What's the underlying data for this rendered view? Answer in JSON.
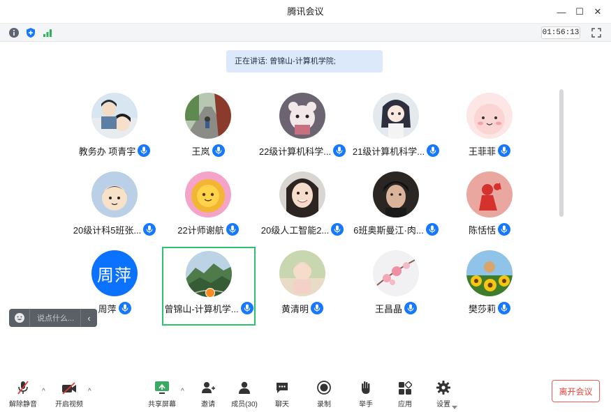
{
  "window": {
    "title": "腾讯会议",
    "minimize_label": "—",
    "maximize_label": "☐",
    "close_label": "✕"
  },
  "toolbar": {
    "timer": "01:56:13"
  },
  "speaking": {
    "text": "正在讲话: 曾锦山-计算机学院;"
  },
  "participants": [
    {
      "name": "教务办 项青宇",
      "avatar": "comic"
    },
    {
      "name": "王岚",
      "avatar": "road"
    },
    {
      "name": "22级计算机科学...",
      "avatar": "plush"
    },
    {
      "name": "21级计算机科学...",
      "avatar": "anime"
    },
    {
      "name": "王菲菲",
      "avatar": "pink-face"
    },
    {
      "name": "20级计科5班张...",
      "avatar": "cartoon-kid"
    },
    {
      "name": "22计师谢航",
      "avatar": "sun"
    },
    {
      "name": "20级人工智能2...",
      "avatar": "girl"
    },
    {
      "name": "6班奥斯曼江·肉...",
      "avatar": "boy"
    },
    {
      "name": "陈恬恬",
      "avatar": "red-figure"
    },
    {
      "name": "周萍",
      "avatar_text": "周萍"
    },
    {
      "name": "曾锦山-计算机学...",
      "avatar": "mountain",
      "active": true
    },
    {
      "name": "黄清明",
      "avatar": "baby"
    },
    {
      "name": "王昌晶",
      "avatar": "blossom"
    },
    {
      "name": "樊莎莉",
      "avatar": "sunflower"
    }
  ],
  "chat": {
    "placeholder": "说点什么..."
  },
  "controls": {
    "unmute": "解除静音",
    "video": "开启视频",
    "share": "共享屏幕",
    "invite": "邀请",
    "members": "成员(30)",
    "chat": "聊天",
    "record": "录制",
    "raise": "举手",
    "apps": "应用",
    "settings": "设置",
    "leave": "离开会议"
  },
  "colors": {
    "accent": "#1677ff",
    "active_border": "#2bc36b",
    "leave": "#f0413b",
    "signal": "#2db45a"
  }
}
